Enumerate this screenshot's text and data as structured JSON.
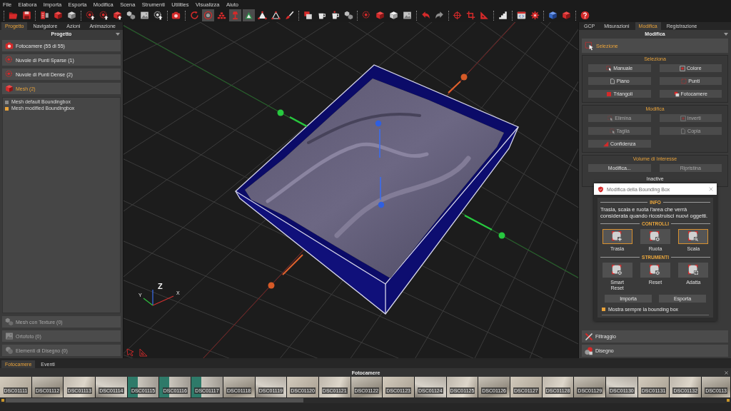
{
  "menu": [
    "File",
    "Elabora",
    "Importa",
    "Esporta",
    "Modifica",
    "Scena",
    "Strumenti",
    "Utilities",
    "Visualizza",
    "Aiuto"
  ],
  "toolbar": [
    {
      "pressed": false
    },
    {
      "pressed": false
    },
    {
      "pressed": false
    },
    {
      "pressed": false
    },
    {
      "pressed": false
    },
    {
      "pressed": false
    },
    {
      "pressed": false
    },
    {
      "pressed": false
    },
    {
      "pressed": false
    },
    {
      "pressed": false
    },
    {
      "pressed": false
    },
    {
      "pressed": false
    },
    {
      "pressed": false
    },
    {
      "pressed": true
    },
    {
      "pressed": false
    },
    {
      "pressed": true
    },
    {
      "pressed": true
    },
    {
      "pressed": false
    },
    {
      "pressed": false
    },
    {
      "pressed": false
    },
    {
      "pressed": false
    },
    {
      "pressed": false
    },
    {
      "pressed": false
    },
    {
      "pressed": false
    },
    {
      "pressed": false
    },
    {
      "pressed": false
    },
    {
      "pressed": false
    },
    {
      "pressed": false
    },
    {
      "pressed": false
    },
    {
      "pressed": false
    },
    {
      "pressed": false
    },
    {
      "pressed": false
    },
    {
      "pressed": false
    },
    {
      "pressed": false
    },
    {
      "pressed": false
    },
    {
      "pressed": false
    },
    {
      "pressed": false
    },
    {
      "pressed": false
    },
    {
      "pressed": false
    }
  ],
  "left_panel": {
    "tabs": [
      {
        "label": "Progetto",
        "selected": true
      },
      {
        "label": "Navigatore",
        "selected": false
      },
      {
        "label": "Azioni",
        "selected": false
      },
      {
        "label": "Animazione",
        "selected": false
      }
    ],
    "title": "Progetto",
    "sections": [
      {
        "label": "Fotocamere (55 di 55)",
        "selected": false
      },
      {
        "label": "Nuvole di Punti Sparse (1)",
        "selected": false
      },
      {
        "label": "Nuvole di Punti Dense (2)",
        "selected": false
      },
      {
        "label": "Mesh (2)",
        "selected": true
      }
    ],
    "mesh_list": [
      {
        "label": "Mesh default Boundingbox",
        "selected": false
      },
      {
        "label": "Mesh modified Boundingbox",
        "selected": true
      }
    ],
    "more_sections": [
      {
        "label": "Mesh con Texture (0)",
        "disabled": true
      },
      {
        "label": "Ortofoto (0)",
        "disabled": true
      },
      {
        "label": "Elementi di Disegno (0)",
        "disabled": true
      }
    ]
  },
  "viewport": {
    "axis_labels": {
      "z": "Z",
      "y": "Y",
      "x": "X"
    }
  },
  "right_panel": {
    "tabs": [
      {
        "label": "GCP",
        "selected": false
      },
      {
        "label": "Misurazioni",
        "selected": false
      },
      {
        "label": "Modifica",
        "selected": true
      },
      {
        "label": "Registrazione",
        "selected": false
      }
    ],
    "title": "Modifica",
    "selection": {
      "label": "Selezione",
      "selected": true
    },
    "groups": [
      {
        "title": "Seleziona",
        "buttons": [
          {
            "label": "Manuale",
            "disabled": false
          },
          {
            "label": "Colore",
            "disabled": false
          },
          {
            "label": "Piano",
            "disabled": false
          },
          {
            "label": "Punti",
            "disabled": false
          },
          {
            "label": "Triangoli",
            "disabled": false
          },
          {
            "label": "Fotocamere",
            "disabled": false
          }
        ]
      },
      {
        "title": "Modifica",
        "buttons": [
          {
            "label": "Elimina",
            "disabled": true
          },
          {
            "label": "Inverti",
            "disabled": true
          },
          {
            "label": "Taglia",
            "disabled": true
          },
          {
            "label": "Copia",
            "disabled": true
          },
          {
            "label": "Confidenza",
            "disabled": false
          }
        ]
      },
      {
        "title": "Volume di Interesse",
        "buttons": [
          {
            "label": "Modifica...",
            "disabled": false
          },
          {
            "label": "Ripristina",
            "disabled": true
          }
        ],
        "status": "Inactive"
      }
    ],
    "footer_sections": [
      {
        "label": "Filtraggio",
        "selected": false
      },
      {
        "label": "Disegno",
        "selected": false
      }
    ]
  },
  "dialog": {
    "title": "Modifica della Bounding Box",
    "info_heading": "INFO",
    "info_text": "Trasla, scala e ruota l'area che verrà considerata quando ricostruisci nuovi oggetti.",
    "controls_heading": "CONTROLLI",
    "controls": [
      {
        "label": "Trasla",
        "selected": true
      },
      {
        "label": "Ruota",
        "selected": false
      },
      {
        "label": "Scala",
        "selected": true
      }
    ],
    "tools_heading": "STRUMENTI",
    "tools": [
      {
        "label": "Smart Reset"
      },
      {
        "label": "Reset"
      },
      {
        "label": "Adatta"
      }
    ],
    "buttons": [
      "Importa",
      "Esporta"
    ],
    "show_always": {
      "label": "Mostra sempre la bounding box",
      "checked": true
    }
  },
  "bottom_panel": {
    "tabs": [
      {
        "label": "Fotocamere",
        "selected": true
      },
      {
        "label": "Eventi",
        "selected": false
      }
    ],
    "title": "Fotocamere",
    "thumbnails": [
      "DSC01111",
      "DSC01112",
      "DSC01113",
      "DSC01114",
      "DSC01115",
      "DSC01116",
      "DSC01117",
      "DSC01118",
      "DSC01119",
      "DSC01120",
      "DSC01121",
      "DSC01122",
      "DSC01123",
      "DSC01124",
      "DSC01125",
      "DSC01126",
      "DSC01127",
      "DSC01128",
      "DSC01129",
      "DSC01130",
      "DSC01131",
      "DSC01132",
      "DSC0113"
    ]
  }
}
